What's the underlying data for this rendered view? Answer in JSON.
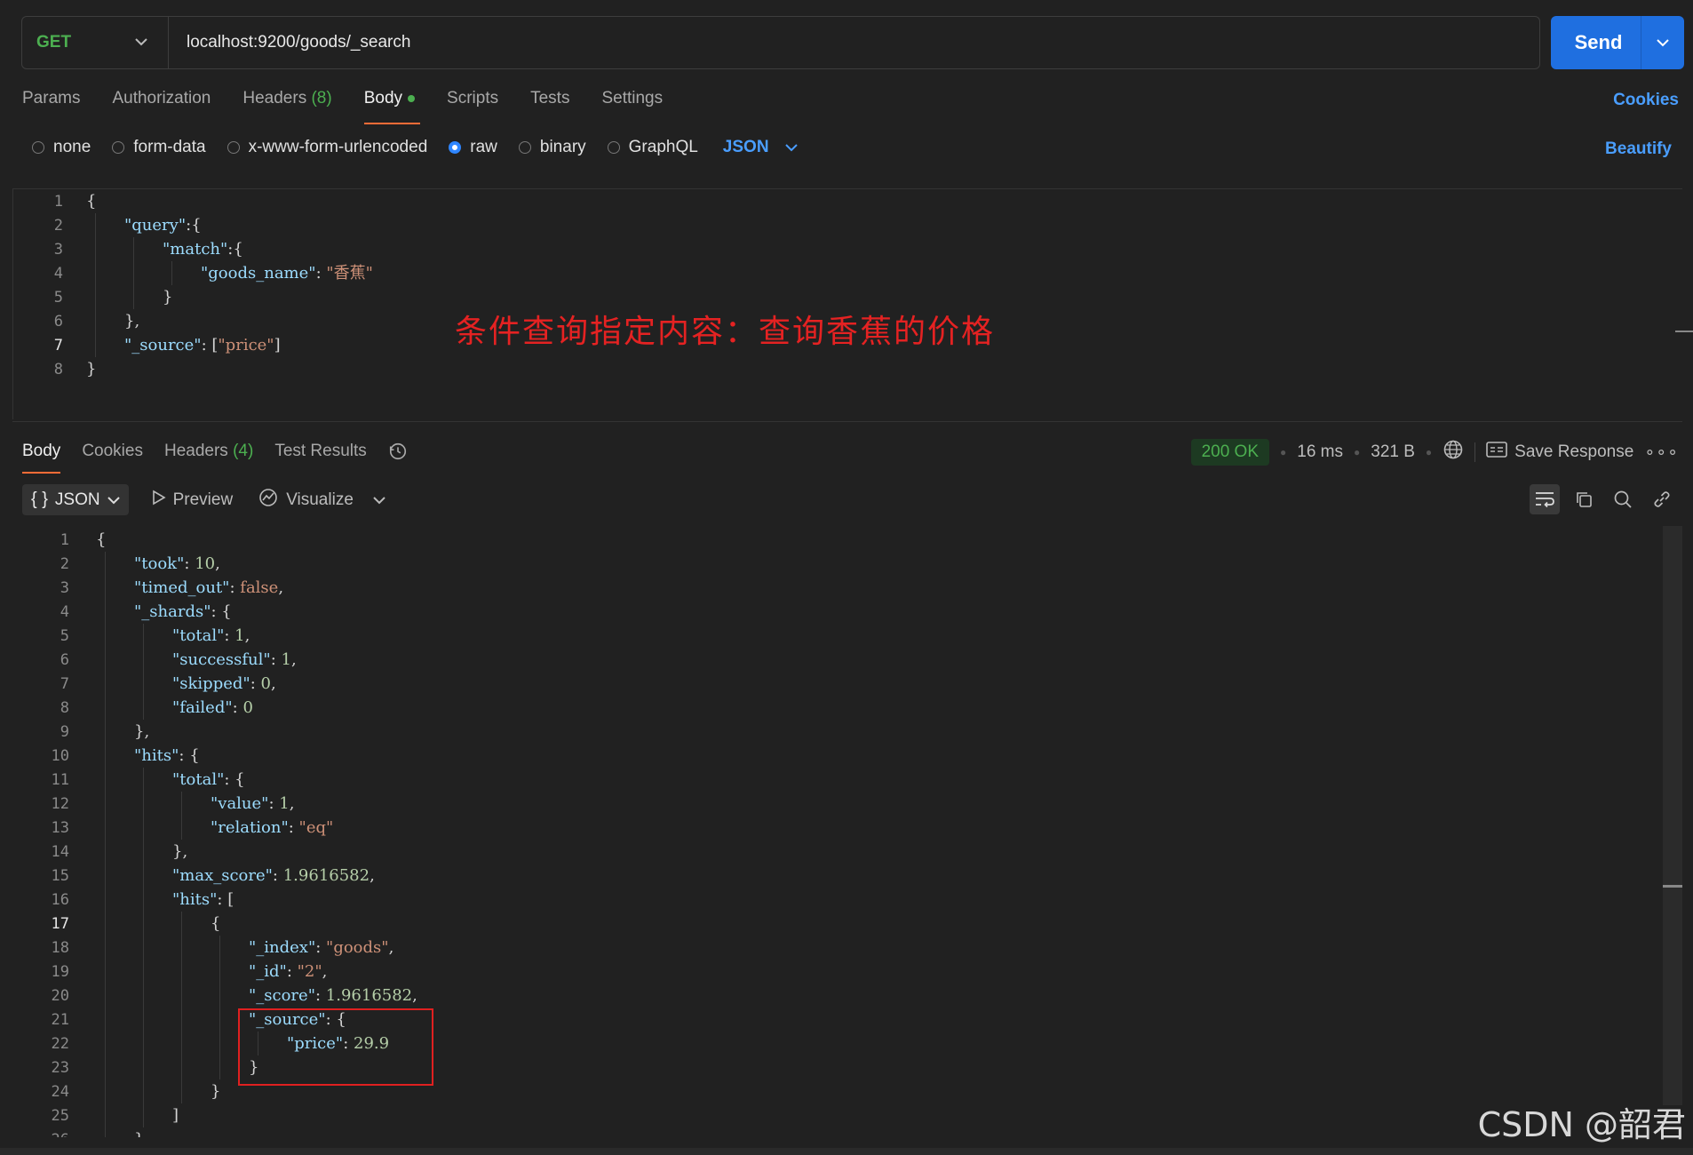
{
  "request": {
    "method": "GET",
    "url": "localhost:9200/goods/_search",
    "send_label": "Send"
  },
  "req_tabs": [
    {
      "label": "Params"
    },
    {
      "label": "Authorization"
    },
    {
      "label": "Headers",
      "count": "(8)"
    },
    {
      "label": "Body",
      "active": true,
      "dot": true
    },
    {
      "label": "Scripts"
    },
    {
      "label": "Tests"
    },
    {
      "label": "Settings"
    }
  ],
  "cookies_label": "Cookies",
  "body_types": {
    "options": [
      "none",
      "form-data",
      "x-www-form-urlencoded",
      "raw",
      "binary",
      "GraphQL"
    ],
    "selected": "raw",
    "format": "JSON",
    "beautify_label": "Beautify"
  },
  "request_body": {
    "lines": [
      "{",
      "    \"query\":{",
      "        \"match\":{",
      "            \"goods_name\": \"香蕉\"",
      "        }",
      "    },",
      "    \"_source\": [\"price\"]",
      "}"
    ],
    "current_line": 7
  },
  "annotation": "条件查询指定内容：查询香蕉的价格",
  "response": {
    "tabs": [
      {
        "label": "Body",
        "active": true
      },
      {
        "label": "Cookies"
      },
      {
        "label": "Headers",
        "count": "(4)"
      },
      {
        "label": "Test Results"
      }
    ],
    "status": "200 OK",
    "time": "16 ms",
    "size": "321 B",
    "save_label": "Save Response",
    "format_label": "JSON",
    "preview_label": "Preview",
    "visualize_label": "Visualize",
    "current_line": 17,
    "lines": [
      "{",
      "    \"took\": 10,",
      "    \"timed_out\": false,",
      "    \"_shards\": {",
      "        \"total\": 1,",
      "        \"successful\": 1,",
      "        \"skipped\": 0,",
      "        \"failed\": 0",
      "    },",
      "    \"hits\": {",
      "        \"total\": {",
      "            \"value\": 1,",
      "            \"relation\": \"eq\"",
      "        },",
      "        \"max_score\": 1.9616582,",
      "        \"hits\": [",
      "            {",
      "                \"_index\": \"goods\",",
      "                \"_id\": \"2\",",
      "                \"_score\": 1.9616582,",
      "                \"_source\": {",
      "                    \"price\": 29.9",
      "                }",
      "            }",
      "        ]",
      "    }"
    ]
  },
  "watermark": "CSDN @韶君",
  "colors": {
    "background": "#212121",
    "accent": "#1f6fe0",
    "link": "#4a9eff",
    "success": "#4caf50",
    "active_tab": "#ff6c37",
    "json_key": "#9cdcfe",
    "json_string": "#ce9178",
    "json_number": "#b5cea8",
    "annotation": "#e52222"
  },
  "icons": [
    "chevron-down-icon",
    "play-icon",
    "visualize-icon",
    "history-icon",
    "globe-icon",
    "save-response-icon",
    "more-icon",
    "wrap-icon",
    "copy-icon",
    "search-icon",
    "link-icon"
  ]
}
